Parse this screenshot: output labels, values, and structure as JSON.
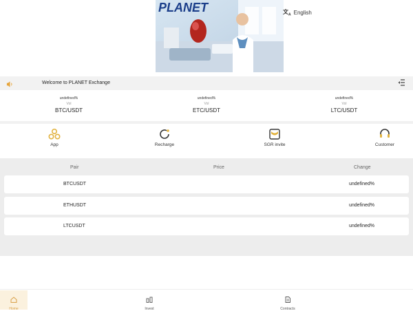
{
  "banner": {
    "brand_text": "PLANET"
  },
  "language": {
    "icon": "translate-icon",
    "label": "English"
  },
  "notice": {
    "icon": "speaker-icon",
    "text": "Welcome to PLANET Exchange",
    "menu_icon": "menu-fold-icon"
  },
  "tickers": [
    {
      "change": "undefined%",
      "volume": "Vol",
      "pair": "BTC/USDT"
    },
    {
      "change": "undefined%",
      "volume": "Vol",
      "pair": "ETC/USDT"
    },
    {
      "change": "undefined%",
      "volume": "Vol",
      "pair": "LTC/USDT"
    }
  ],
  "quick_actions": [
    {
      "label": "App",
      "icon": "app-icon"
    },
    {
      "label": "Recharge",
      "icon": "recharge-icon"
    },
    {
      "label": "SGR invite",
      "icon": "invite-icon"
    },
    {
      "label": "Customer",
      "icon": "customer-service-icon"
    }
  ],
  "market": {
    "headers": {
      "pair": "Pair",
      "price": "Price",
      "change": "Change"
    },
    "rows": [
      {
        "pair": "BTCUSDT",
        "price": "",
        "change": "undefined%"
      },
      {
        "pair": "ETHUSDT",
        "price": "",
        "change": "undefined%"
      },
      {
        "pair": "LTCUSDT",
        "price": "",
        "change": "undefined%"
      }
    ]
  },
  "bottom_nav": [
    {
      "label": "Home",
      "icon": "home-icon",
      "active": true
    },
    {
      "label": "Invest",
      "icon": "invest-icon",
      "active": false
    },
    {
      "label": "Contracts",
      "icon": "contracts-icon",
      "active": false
    }
  ],
  "colors": {
    "accent": "#d8a048",
    "icon_gold": "#e2b33f",
    "section_gray": "#ededed"
  }
}
